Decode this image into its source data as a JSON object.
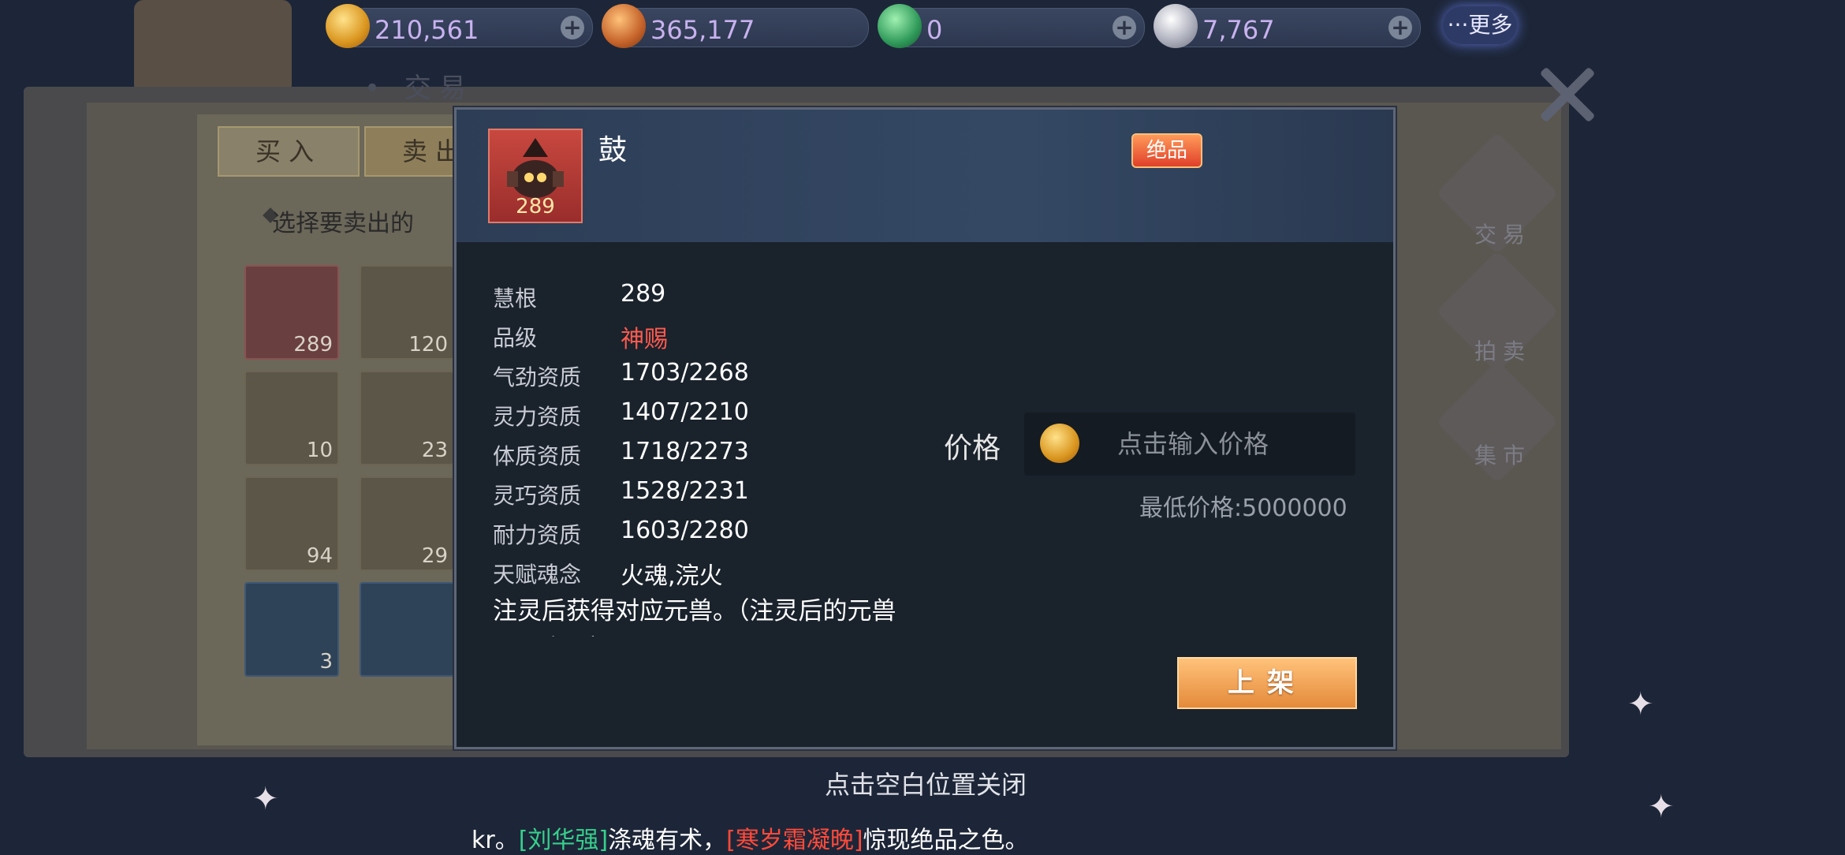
{
  "currencies": [
    {
      "name": "gold-coin-icon",
      "value": "210,561"
    },
    {
      "name": "bronze-shell-icon",
      "value": "365,177"
    },
    {
      "name": "jade-shell-icon",
      "value": "0"
    },
    {
      "name": "silver-shell-icon",
      "value": "7,767"
    }
  ],
  "more_label": "···更多",
  "page_title": "• 交易",
  "tabs": [
    "买入",
    "卖出"
  ],
  "select_hint": "选择要卖出的",
  "inventory": [
    {
      "count": "289"
    },
    {
      "count": "120"
    },
    {
      "count": "10"
    },
    {
      "count": "23"
    },
    {
      "count": "94"
    },
    {
      "count": "29"
    },
    {
      "count": "3"
    },
    {
      "count": ""
    }
  ],
  "side_menu": [
    "交易",
    "拍卖",
    "集市"
  ],
  "item": {
    "level": "289",
    "name": "鼓",
    "rarity": "绝品",
    "attributes": [
      {
        "label": "慧根",
        "value": "289"
      },
      {
        "label": "品级",
        "value": "神赐"
      },
      {
        "label": "气劲资质",
        "value": "1703/2268"
      },
      {
        "label": "灵力资质",
        "value": "1407/2210"
      },
      {
        "label": "体质资质",
        "value": "1718/2273"
      },
      {
        "label": "灵巧资质",
        "value": "1528/2231"
      },
      {
        "label": "耐力资质",
        "value": "1603/2280"
      },
      {
        "label": "天赋魂念",
        "value": "火魂,浣火"
      }
    ],
    "description": "注灵后获得对应元兽。（注灵后的元兽不可交易）"
  },
  "price": {
    "label": "价格",
    "placeholder": "点击输入价格",
    "min_price": "最低价格:5000000"
  },
  "list_button": "上架",
  "close_hint": "点击空白位置关闭",
  "ticker": {
    "prefix": "kr。",
    "name1": "[刘华强]",
    "mid": "涤魂有术，",
    "name2": "[寒岁霜凝晚]",
    "suffix": "惊现绝品之色。"
  },
  "colors": {
    "grade_red": "#ff5a4e",
    "ticker_green": "#36d08c",
    "ticker_red": "#ff4a3a",
    "currency_text": "#c8b2ee"
  }
}
